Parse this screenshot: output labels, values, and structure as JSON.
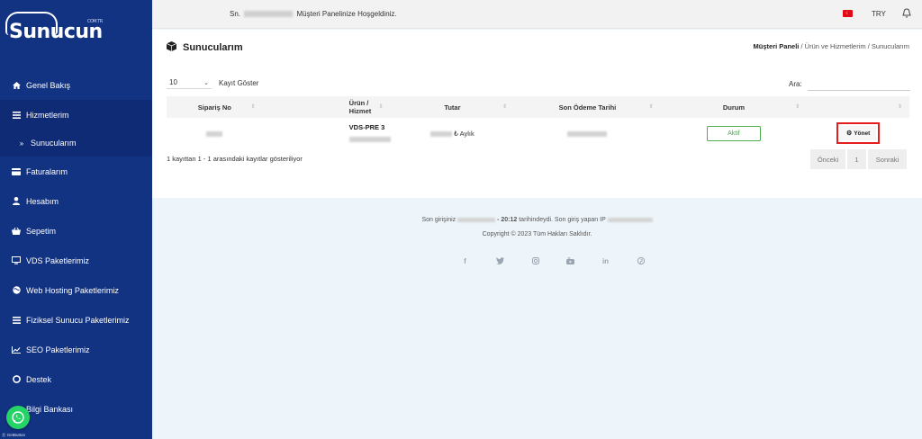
{
  "brand": {
    "name": "Sunucun",
    "tag": "COM.TR"
  },
  "sidebar": {
    "items": [
      {
        "label": "Genel Bakış",
        "icon": "home-icon"
      },
      {
        "label": "Hizmetlerim",
        "icon": "list-icon"
      },
      {
        "label": "Sunucularım",
        "icon": "chevron-right-icon",
        "sub": true
      },
      {
        "label": "Faturalarım",
        "icon": "credit-card-icon"
      },
      {
        "label": "Hesabım",
        "icon": "user-icon"
      },
      {
        "label": "Sepetim",
        "icon": "basket-icon"
      },
      {
        "label": "VDS Paketlerimiz",
        "icon": "desktop-icon"
      },
      {
        "label": "Web Hosting Paketlerimiz",
        "icon": "globe-icon"
      },
      {
        "label": "Fiziksel Sunucu Paketlerimiz",
        "icon": "server-icon"
      },
      {
        "label": "SEO Paketlerimiz",
        "icon": "chart-line-icon"
      },
      {
        "label": "Destek",
        "icon": "lifebuoy-icon"
      },
      {
        "label": "Bilgi Bankası",
        "icon": "book-icon"
      }
    ],
    "whatsapp_label": "GetButton"
  },
  "topbar": {
    "welcome_prefix": "Sn.",
    "welcome_suffix": "Müşteri Panelinize Hoşgeldiniz.",
    "currency": "TRY",
    "flag_color": "#e30a17"
  },
  "page": {
    "title": "Sunucularım",
    "breadcrumb": {
      "home": "Müşteri Paneli",
      "sep1": "/",
      "mid": "Ürün ve Hizmetlerim",
      "sep2": "/",
      "current": "Sunucularım"
    }
  },
  "table_controls": {
    "page_length": "10",
    "page_length_label": "Kayıt Göster",
    "search_label": "Ara:",
    "search_value": ""
  },
  "table": {
    "columns": [
      "Sipariş No",
      "Ürün / Hizmet",
      "Tutar",
      "Son Ödeme Tarihi",
      "Durum",
      ""
    ],
    "rows": [
      {
        "product": "VDS-PRE 3",
        "amount_suffix": "₺ Aylık",
        "status": "Aktif",
        "action": "Yönet"
      }
    ]
  },
  "table_info": "1 kayıttan 1 - 1 arasındaki kayıtlar gösteriliyor",
  "pagination": {
    "prev": "Önceki",
    "current": "1",
    "next": "Sonraki"
  },
  "footer": {
    "last_login_prefix": "Son girişiniz",
    "last_login_time": "- 20:12",
    "last_login_middle": "tarihindeydi. Son giriş yapan IP",
    "copyright": "Copyright © 2023 Tüm Hakları Saklıdır.",
    "social": [
      "facebook-icon",
      "twitter-icon",
      "instagram-icon",
      "youtube-icon",
      "linkedin-icon",
      "pinterest-icon"
    ]
  },
  "colors": {
    "sidebar": "#123282",
    "status_active": "#4cae4c",
    "highlight": "#e41e1e",
    "whatsapp": "#25d366"
  }
}
